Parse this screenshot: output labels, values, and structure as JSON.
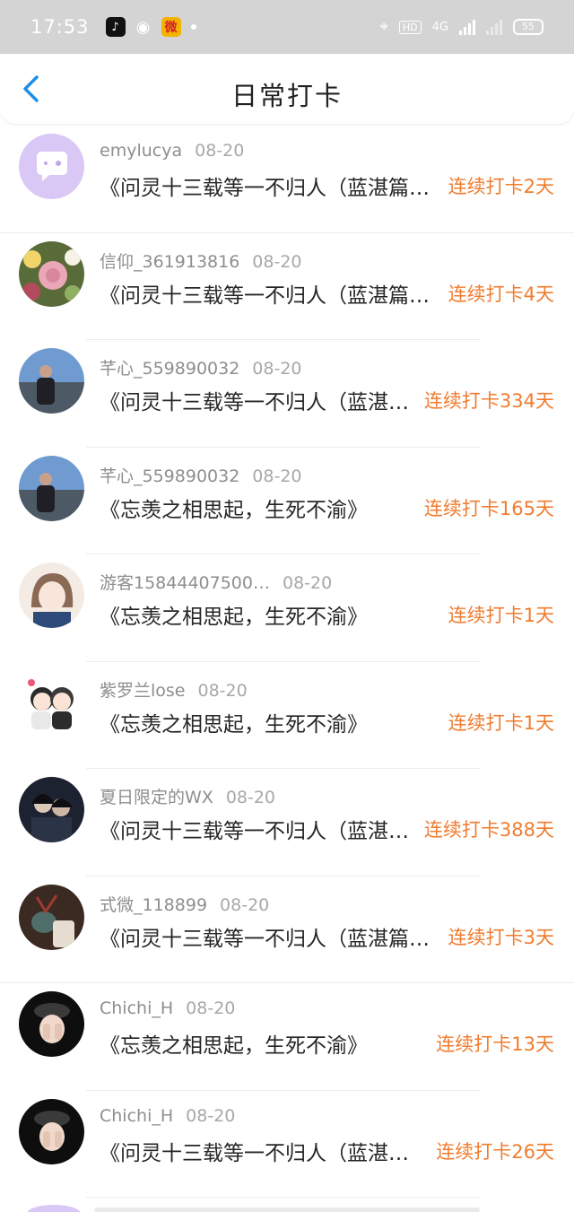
{
  "status_bar": {
    "time": "17:53",
    "battery": "55",
    "network": "4G",
    "hd": "HD"
  },
  "header": {
    "title": "日常打卡"
  },
  "entries": [
    {
      "user": "emylucya",
      "date": "08-20",
      "title": "《问灵十三载等一不归人（蓝湛篇…",
      "streak": "连续打卡2天"
    },
    {
      "user": "信仰_361913816",
      "date": "08-20",
      "title": "《问灵十三载等一不归人（蓝湛篇…",
      "streak": "连续打卡4天"
    },
    {
      "user": "芊心_559890032",
      "date": "08-20",
      "title": "《问灵十三载等一不归人（蓝湛…",
      "streak": "连续打卡334天"
    },
    {
      "user": "芊心_559890032",
      "date": "08-20",
      "title": "《忘羡之相思起，生死不渝》",
      "streak": "连续打卡165天"
    },
    {
      "user": "游客15844407500…",
      "date": "08-20",
      "title": "《忘羡之相思起，生死不渝》",
      "streak": "连续打卡1天"
    },
    {
      "user": "紫罗兰lose",
      "date": "08-20",
      "title": "《忘羡之相思起，生死不渝》",
      "streak": "连续打卡1天"
    },
    {
      "user": "夏日限定的WX",
      "date": "08-20",
      "title": "《问灵十三载等一不归人（蓝湛…",
      "streak": "连续打卡388天"
    },
    {
      "user": "式微_118899",
      "date": "08-20",
      "title": "《问灵十三载等一不归人（蓝湛篇…",
      "streak": "连续打卡3天"
    },
    {
      "user": "Chichi_H",
      "date": "08-20",
      "title": "《忘羡之相思起，生死不渝》",
      "streak": "连续打卡13天"
    },
    {
      "user": "Chichi_H",
      "date": "08-20",
      "title": "《问灵十三载等一不归人（蓝湛…",
      "streak": "连续打卡26天"
    }
  ],
  "colors": {
    "accent": "#1e8fe8",
    "streak": "#f07c2f",
    "status_bar_bg": "#d4d4d4"
  }
}
